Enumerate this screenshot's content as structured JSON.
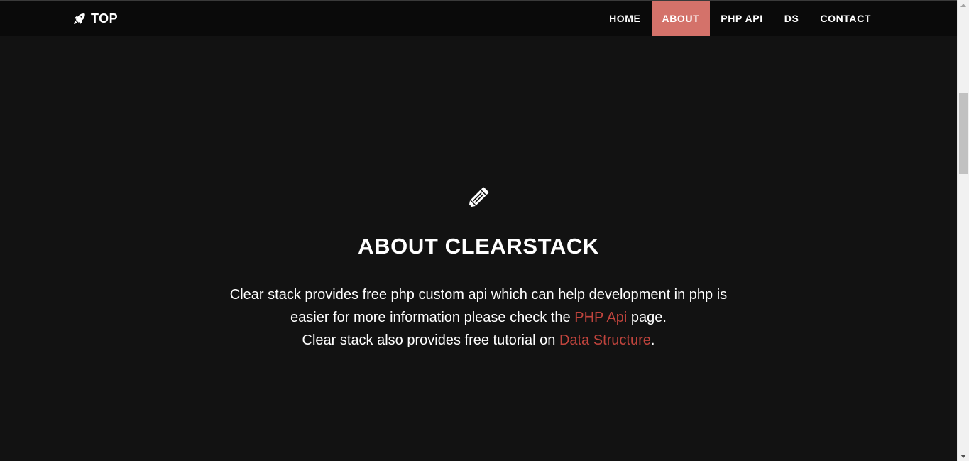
{
  "navbar": {
    "brand_icon": "rocket-icon",
    "brand_label": "TOP",
    "items": [
      {
        "label": "HOME",
        "active": false
      },
      {
        "label": "ABOUT",
        "active": true
      },
      {
        "label": "PHP API",
        "active": false
      },
      {
        "label": "DS",
        "active": false
      },
      {
        "label": "CONTACT",
        "active": false
      }
    ],
    "active_color": "#d4726a"
  },
  "about": {
    "icon": "pencil-icon",
    "title": "ABOUT CLEARSTACK",
    "line1": "Clear stack provides free php custom api which can help development in php is",
    "line2_before": "easier for more information please check the ",
    "line2_link": "PHP Api",
    "line2_after": " page.",
    "line3_before": "Clear stack also provides free tutorial on ",
    "line3_link": "Data Structure",
    "line3_after": ".",
    "link_color": "#c0443d"
  },
  "colors": {
    "background": "#121212",
    "navbar_bg": "#0a0a0a",
    "text": "#ffffff"
  }
}
